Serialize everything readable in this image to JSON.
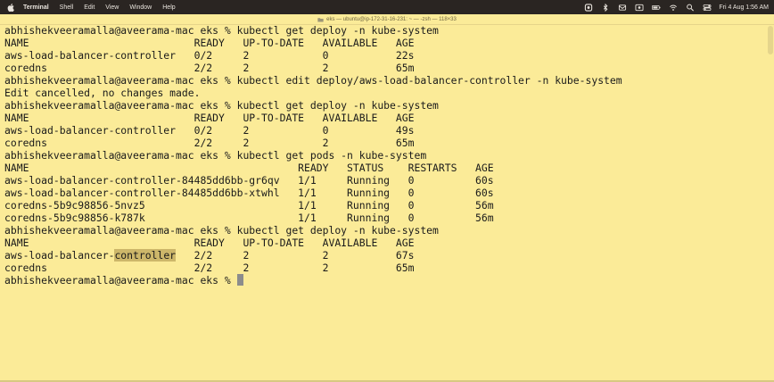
{
  "menubar": {
    "app": "Terminal",
    "items": [
      "Shell",
      "Edit",
      "View",
      "Window",
      "Help"
    ],
    "clock": "Fri 4 Aug  1:56 AM"
  },
  "window": {
    "title": "eks — ubuntu@ip-172-31-16-231: ~ — -zsh — 118×33"
  },
  "terminal": {
    "lines": [
      "abhishekveeramalla@aveerama-mac eks % kubectl get deploy -n kube-system",
      "NAME                           READY   UP-TO-DATE   AVAILABLE   AGE",
      "aws-load-balancer-controller   0/2     2            0           22s",
      "coredns                        2/2     2            2           65m",
      "abhishekveeramalla@aveerama-mac eks % kubectl edit deploy/aws-load-balancer-controller -n kube-system",
      "Edit cancelled, no changes made.",
      "abhishekveeramalla@aveerama-mac eks % kubectl get deploy -n kube-system",
      "NAME                           READY   UP-TO-DATE   AVAILABLE   AGE",
      "aws-load-balancer-controller   0/2     2            0           49s",
      "coredns                        2/2     2            2           65m",
      "abhishekveeramalla@aveerama-mac eks % kubectl get pods -n kube-system",
      "NAME                                            READY   STATUS    RESTARTS   AGE",
      "aws-load-balancer-controller-84485dd6bb-gr6qv   1/1     Running   0          60s",
      "aws-load-balancer-controller-84485dd6bb-xtwhl   1/1     Running   0          60s",
      "coredns-5b9c98856-5nvz5                         1/1     Running   0          56m",
      "coredns-5b9c98856-k787k                         1/1     Running   0          56m",
      "abhishekveeramalla@aveerama-mac eks % kubectl get deploy -n kube-system",
      "NAME                           READY   UP-TO-DATE   AVAILABLE   AGE"
    ],
    "highlight_line": {
      "before": "aws-load-balancer-",
      "highlighted": "controller",
      "after": "   2/2     2            2           67s"
    },
    "after_lines": [
      "coredns                        2/2     2            2           65m"
    ],
    "prompt": "abhishekveeramalla@aveerama-mac eks % "
  }
}
